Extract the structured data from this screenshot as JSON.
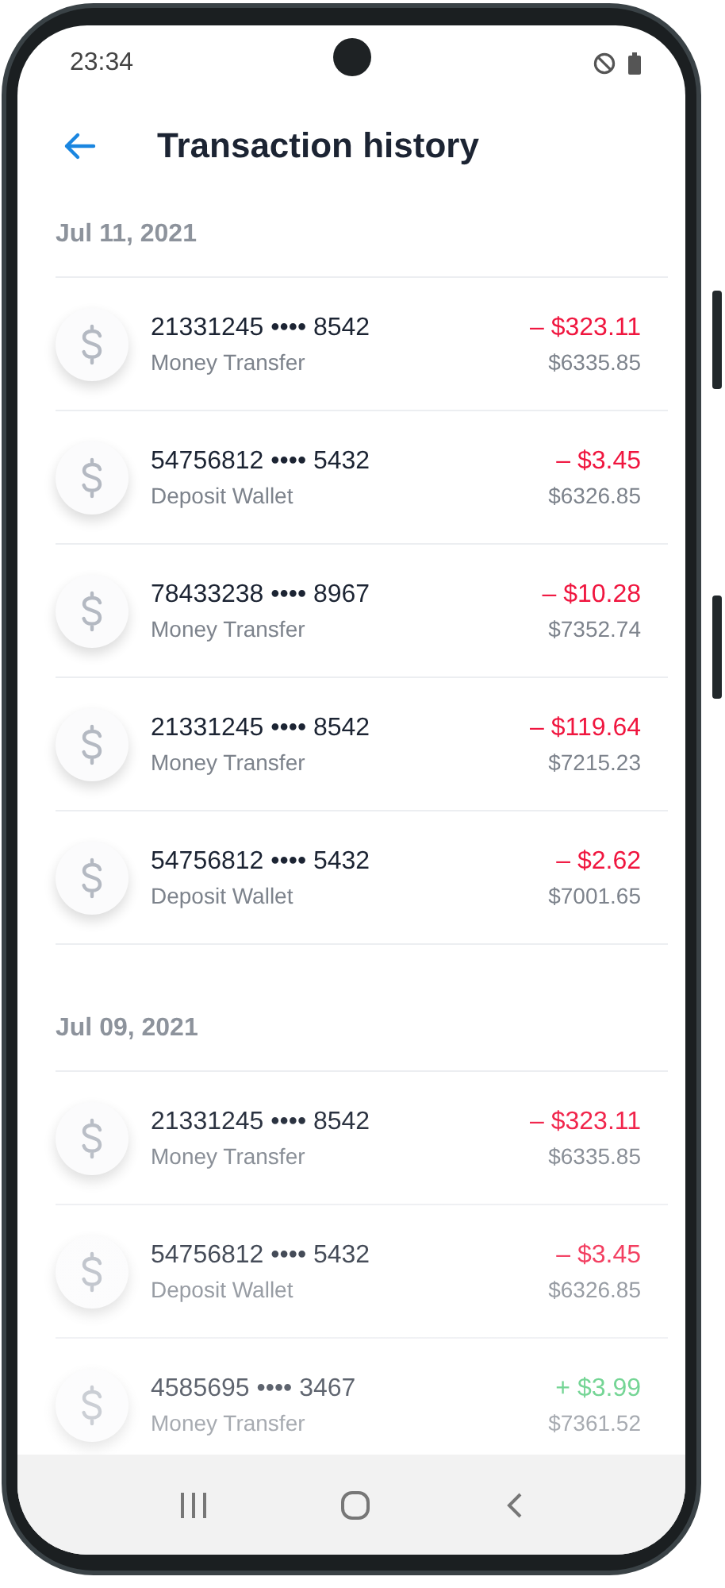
{
  "status_bar": {
    "time": "23:34"
  },
  "header": {
    "title": "Transaction history"
  },
  "groups": [
    {
      "date": "Jul 11, 2021",
      "transactions": [
        {
          "account": "21331245 •••• 8542",
          "type": "Money Transfer",
          "amount": "– $323.11",
          "kind": "debit",
          "balance": "$6335.85"
        },
        {
          "account": "54756812 •••• 5432",
          "type": "Deposit Wallet",
          "amount": "– $3.45",
          "kind": "debit",
          "balance": "$6326.85"
        },
        {
          "account": "78433238 •••• 8967",
          "type": "Money Transfer",
          "amount": "– $10.28",
          "kind": "debit",
          "balance": "$7352.74"
        },
        {
          "account": "21331245 •••• 8542",
          "type": "Money Transfer",
          "amount": "– $119.64",
          "kind": "debit",
          "balance": "$7215.23"
        },
        {
          "account": "54756812 •••• 5432",
          "type": "Deposit Wallet",
          "amount": "– $2.62",
          "kind": "debit",
          "balance": "$7001.65"
        }
      ]
    },
    {
      "date": "Jul 09, 2021",
      "transactions": [
        {
          "account": "21331245 •••• 8542",
          "type": "Money Transfer",
          "amount": "– $323.11",
          "kind": "debit",
          "balance": "$6335.85"
        },
        {
          "account": "54756812 •••• 5432",
          "type": "Deposit Wallet",
          "amount": "– $3.45",
          "kind": "debit",
          "balance": "$6326.85"
        },
        {
          "account": "4585695 •••• 3467",
          "type": "Money Transfer",
          "amount": "+ $3.99",
          "kind": "credit",
          "balance": "$7361.52"
        }
      ]
    }
  ]
}
